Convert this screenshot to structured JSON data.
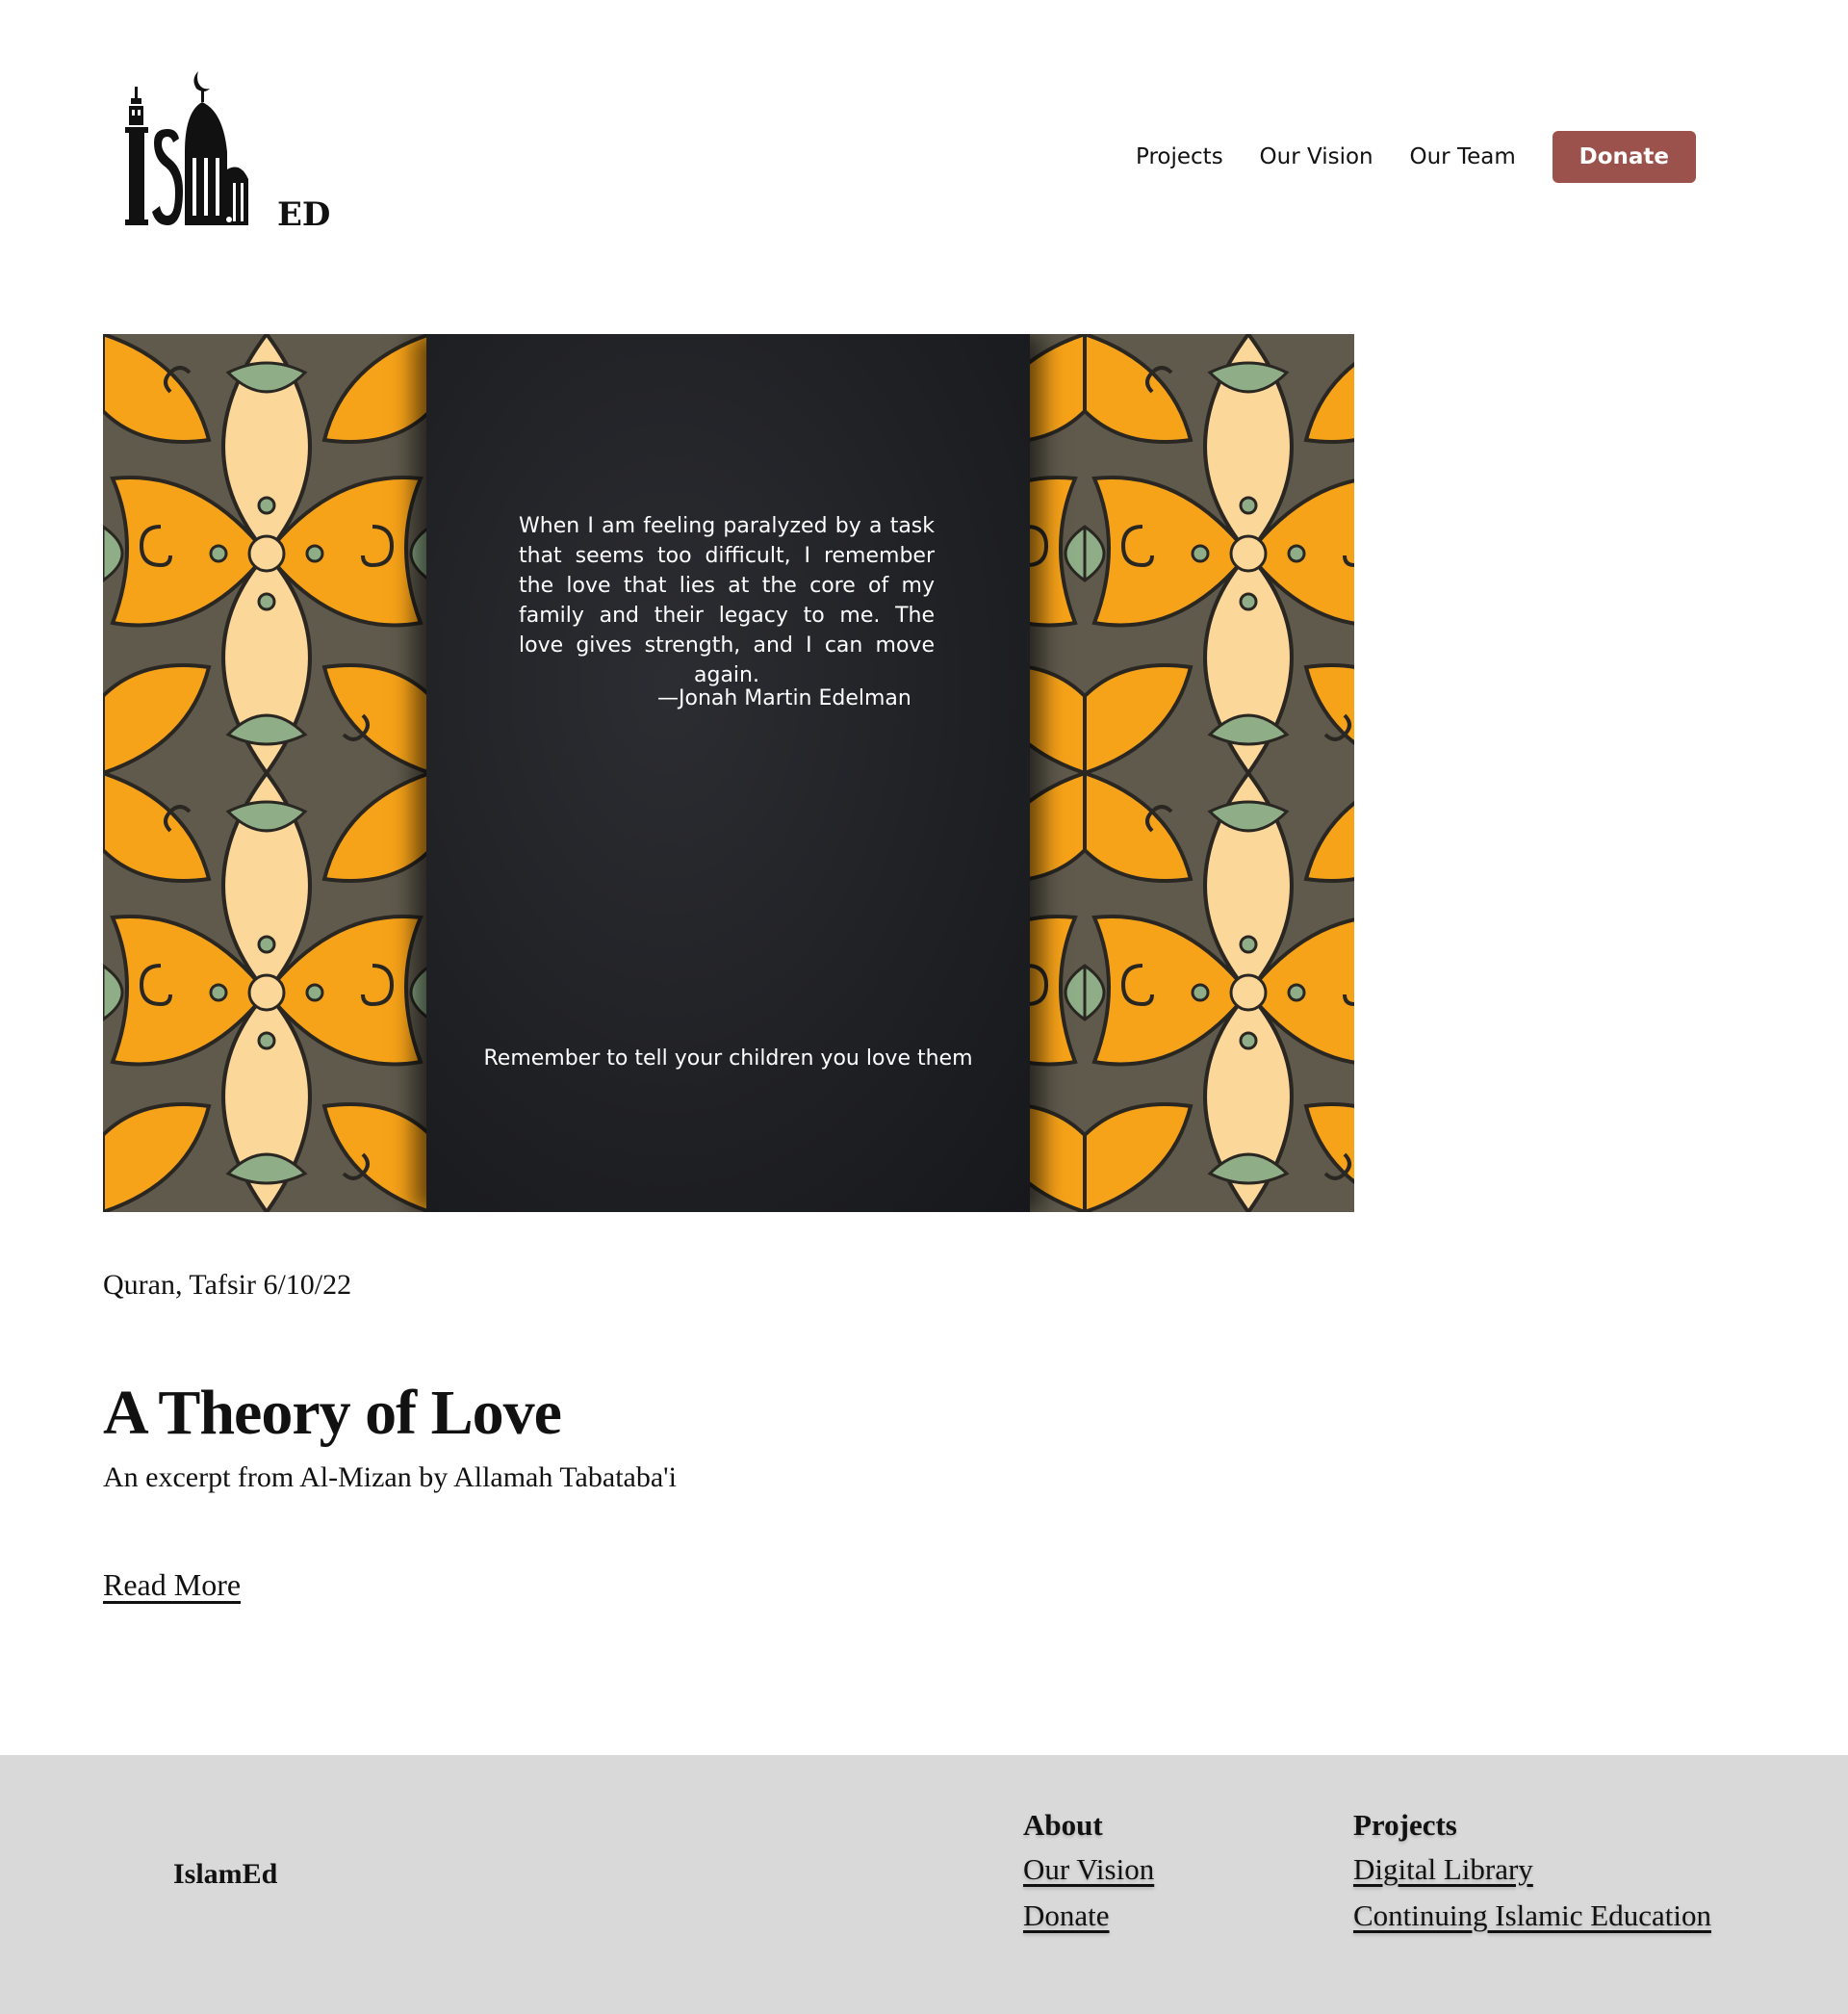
{
  "header": {
    "logo_text": "IslamED",
    "nav": {
      "projects": "Projects",
      "our_vision": "Our Vision",
      "our_team": "Our Team",
      "donate": "Donate"
    },
    "accent_color": "#9c524c"
  },
  "hero": {
    "quote": "When I am feeling paralyzed by a task that seems too difficult, I remember the love that lies at the core of my family and their legacy to me. The love gives strength, and I can move again.",
    "attribution": "—Jonah Martin Edelman",
    "tagline": "Remember to tell your children you love them",
    "pattern_colors": [
      "#f7a319",
      "#fcd79a",
      "#8fae87",
      "#5f5a4c",
      "#2a2722"
    ]
  },
  "article": {
    "meta": "Quran, Tafsir 6/10/22",
    "title": "A Theory of Love",
    "subtitle": "An excerpt from Al-Mizan by Allamah Tabataba'i",
    "read_more": "Read More"
  },
  "footer": {
    "brand": "IslamEd",
    "about": {
      "heading": "About",
      "links": [
        "Our Vision",
        "Donate"
      ]
    },
    "projects": {
      "heading": "Projects",
      "links": [
        "Digital Library",
        "Continuing Islamic Education"
      ]
    },
    "background": "#d9d9d9"
  }
}
